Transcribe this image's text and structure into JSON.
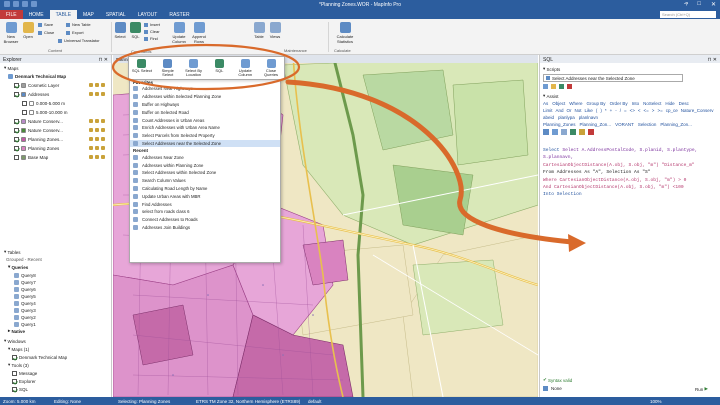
{
  "window": {
    "title": "*Planning Zones.WOR - MapInfo Pro",
    "help": "?"
  },
  "tabs": [
    "FILE",
    "HOME",
    "TABLE",
    "MAP",
    "SPATIAL",
    "LAYOUT",
    "RASTER"
  ],
  "search_placeholder": "Search (Ctrl+Q)",
  "ribbon": {
    "new_browser": "New Browser",
    "open": "Open",
    "save": "Save",
    "close": "Close",
    "new_table": "New Table",
    "export": "Export",
    "universal_translator": "Universal Translator",
    "group_content": "Content",
    "select": "Select",
    "sql": "SQL",
    "insert": "Insert",
    "clear": "Clear",
    "find": "Find",
    "update_column": "Update Column",
    "append_rows": "Append Rows",
    "table": "Table",
    "views": "Views",
    "calculate_statistics": "Calculate Statistics",
    "group_maintenance": "Maintenance",
    "group_calculate": "Calculate",
    "group_commands": "Commands"
  },
  "popup": [
    {
      "label": "SQL Select",
      "icon": "sql-select-icon"
    },
    {
      "label": "Simple Select",
      "icon": "simple-select-icon"
    },
    {
      "label": "Select By Location",
      "icon": "select-by-location-icon"
    },
    {
      "label": "SQL",
      "icon": "sql-icon"
    },
    {
      "label": "Update Column",
      "icon": "update-column-icon"
    },
    {
      "label": "Close Queries",
      "icon": "close-queries-icon"
    }
  ],
  "dropdown": {
    "favorites_label": "Favorites",
    "favorites": [
      "Addresses Near Highways",
      "Addresses within Selected Planning Zone",
      "Buffer on Highways",
      "Buffer on Selected Road",
      "Count Addresses in Urban Areas",
      "Enrich Addresses with Urban Area Name",
      "Select Parcels from Selected Property",
      "Select Addresses near the Selected Zone"
    ],
    "recent_label": "Recent",
    "recent": [
      "Addresses Near Zone",
      "Addresses within Planning Zone",
      "Select Addresses within Selected Zone",
      "Search Column Values",
      "Calculating Road Length by Name",
      "Update Urban Areas with MBR",
      "Find Addresses",
      "select from roads class 6",
      "Connect Addresses to Roads",
      "Addresses Join Buildings"
    ],
    "highlighted_index": 7
  },
  "explorer": {
    "title": "Explorer",
    "maps_label": "Maps",
    "map_name": "Denmark Technical Map",
    "layers": [
      {
        "name": "Cosmetic Layer",
        "checked": true,
        "color": "#9e9e9e"
      },
      {
        "name": "Addresses",
        "checked": true,
        "color": "#5d8bc4"
      },
      {
        "name": "0.000-5.000 m",
        "checked": false,
        "color": "#ffffff"
      },
      {
        "name": "5.000-10.000 m",
        "checked": false,
        "color": "#ffffff"
      },
      {
        "name": "Nature Conserv...",
        "checked": true,
        "color": "#b88ac7"
      },
      {
        "name": "Nature Conserv...",
        "checked": true,
        "color": "#4b8a3b"
      },
      {
        "name": "Planning Zones...",
        "checked": true,
        "color": "#c35aa6"
      },
      {
        "name": "Planning Zones",
        "checked": true,
        "color": "#d983c0"
      },
      {
        "name": "Base Map",
        "checked": false,
        "color": "#7d9a6b"
      }
    ],
    "tables_label": "Tables",
    "tables_filter": "Grouped - Recent",
    "queries_label": "Queries",
    "queries": [
      "Query8",
      "Query7",
      "Query6",
      "Query5",
      "Query4",
      "Query3",
      "Query2",
      "Query1"
    ],
    "native_label": "Native",
    "windows_label": "Windows",
    "windows_maps": "Maps (1)",
    "windows_map_item": "Denmark Technical Map",
    "windows_tools": "Tools (3)",
    "windows_tool_items": [
      "Message",
      "Explorer",
      "SQL"
    ]
  },
  "map": {
    "tab_label": "Planning Zones...",
    "colors": {
      "background": "#efe7c4",
      "zone": "#e7a6d8",
      "zone_dark": "#c56aa9",
      "field": "#b9d9a2",
      "green": "#6d9a4c"
    }
  },
  "sql_panel": {
    "title": "SQL",
    "scripts_label": "Scripts",
    "script_selected": "Select Addresses near the Selected Zone",
    "assist_label": "Assist",
    "keywords": [
      "As",
      "Object",
      "Where",
      "Group By",
      "Order By",
      "Into",
      "NoSelect",
      "Hide",
      "Desc"
    ],
    "keywords2": [
      "Limit",
      "And",
      "Or",
      "Not",
      "Like",
      "(",
      ")",
      "*",
      "+",
      "-",
      "/",
      "=",
      "<>",
      "<",
      "<=",
      ">",
      ">=",
      "cp_ce",
      "Nature_Conserv"
    ],
    "keywords3": [
      "abeid",
      "planlypa",
      "planlnavn"
    ],
    "tables": [
      "Planning_Zones",
      "Planning_Zon...",
      "VORANT",
      "Selection",
      "Planning_Zon..."
    ],
    "code": [
      "Select A.AddressPostalCode, S.planid, S.plantype, S.plannavn,",
      "CartesianObjectDistance(A.obj, S.obj, \"m\") \"Distance_m\"",
      "From Addresses As \"A\", Selection As \"S\"",
      "Where CartesianObjectDistance(A.obj, S.obj, \"m\") > 0",
      "And CartesianObjectDistance(A.obj, S.obj, \"m\") <100",
      "Into Selection"
    ],
    "syntax_valid": "Syntax valid",
    "options": "None",
    "run": "Run"
  },
  "statusbar": {
    "zoom": "Zoom: 5.000 km",
    "editing": "Editing: None",
    "selecting": "Selecting: Planning Zones",
    "projection": "ETRS TM Zone 32, Northern Hemisphere (ETRS89)",
    "mode": "default",
    "percent": "100%"
  },
  "colors": {
    "brand_blue": "#2c5d9e",
    "file_red": "#c23a3a",
    "annotation_orange": "#d96a2b",
    "highlight": "#cfe0f5",
    "sql_keyword": "#1f4f9c",
    "sql_function": "#b5396e"
  }
}
